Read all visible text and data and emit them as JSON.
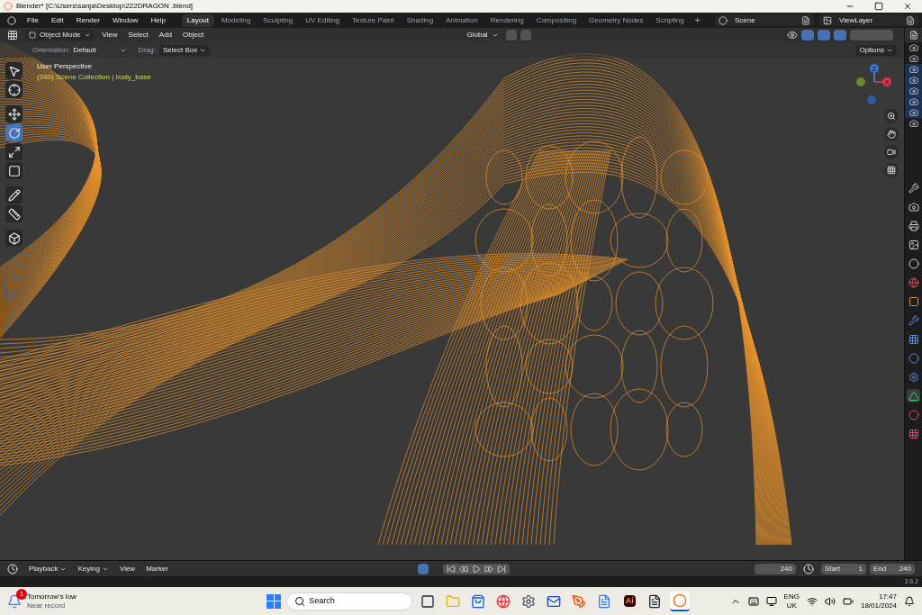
{
  "window": {
    "title": "Blender* [C:\\Users\\sanja\\Desktop\\222DRAGON .blend]"
  },
  "menu": [
    "File",
    "Edit",
    "Render",
    "Window",
    "Help"
  ],
  "workspaces": [
    {
      "label": "Layout",
      "selected": true
    },
    {
      "label": "Modeling",
      "selected": false
    },
    {
      "label": "Sculpting",
      "selected": false
    },
    {
      "label": "UV Editing",
      "selected": false
    },
    {
      "label": "Texture Paint",
      "selected": false
    },
    {
      "label": "Shading",
      "selected": false
    },
    {
      "label": "Animation",
      "selected": false
    },
    {
      "label": "Rendering",
      "selected": false
    },
    {
      "label": "Compositing",
      "selected": false
    },
    {
      "label": "Geometry Nodes",
      "selected": false
    },
    {
      "label": "Scripting",
      "selected": false
    }
  ],
  "add_workspace": "+",
  "scene": "Scene",
  "view_layer": "ViewLayer",
  "header": {
    "mode": "Object Mode",
    "menus": [
      "View",
      "Select",
      "Add",
      "Object"
    ],
    "transform": "Global"
  },
  "tool_settings": {
    "orientation_label": "Orientation:",
    "orientation": "Default",
    "drag_label": "Drag:",
    "drag": "Select Box",
    "options": "Options"
  },
  "viewport": {
    "view_name": "User Perspective",
    "collection": "(240) Scene Collection | body_base",
    "axes": [
      "Z",
      "X"
    ]
  },
  "toolbar": [
    {
      "kind": "select",
      "selected": false
    },
    {
      "kind": "cursor",
      "selected": false
    },
    {
      "kind": "move",
      "selected": false
    },
    {
      "kind": "rotate",
      "selected": true
    },
    {
      "kind": "scale",
      "selected": false
    },
    {
      "kind": "transform",
      "selected": false
    },
    {
      "kind": "annotate",
      "selected": false
    },
    {
      "kind": "measure",
      "selected": false
    },
    {
      "kind": "add",
      "selected": false
    }
  ],
  "outliner": [
    {
      "selected": false
    },
    {
      "selected": false
    },
    {
      "selected": true
    },
    {
      "selected": true
    },
    {
      "selected": true
    },
    {
      "selected": true
    },
    {
      "selected": true
    },
    {
      "selected": false
    }
  ],
  "properties_tabs": [
    {
      "kind": "tool",
      "selected": false
    },
    {
      "kind": "render",
      "selected": false
    },
    {
      "kind": "output",
      "selected": false
    },
    {
      "kind": "view_layer",
      "selected": false
    },
    {
      "kind": "scene",
      "selected": false
    },
    {
      "kind": "world",
      "selected": false
    },
    {
      "kind": "object",
      "selected": false
    },
    {
      "kind": "modifier",
      "selected": false
    },
    {
      "kind": "particles",
      "selected": false
    },
    {
      "kind": "physics",
      "selected": false
    },
    {
      "kind": "constraints",
      "selected": false
    },
    {
      "kind": "data",
      "selected": true
    },
    {
      "kind": "material",
      "selected": false
    },
    {
      "kind": "texture",
      "selected": false
    }
  ],
  "timeline": {
    "menus": [
      "Playback",
      "Keying",
      "View",
      "Marker"
    ],
    "current_frame": "240",
    "start_label": "Start",
    "start": "1",
    "end_label": "End",
    "end": "240"
  },
  "status_bar": {
    "version": "3.6.2"
  },
  "taskbar": {
    "weather_badge": "1",
    "weather_title": "Tomorrow's low",
    "weather_sub": "Near record",
    "search": "Search",
    "apps": [
      {
        "kind": "widgets",
        "selected": false
      },
      {
        "kind": "files",
        "selected": false
      },
      {
        "kind": "store",
        "selected": false
      },
      {
        "kind": "chrome",
        "selected": false
      },
      {
        "kind": "settings",
        "selected": false
      },
      {
        "kind": "outlook",
        "selected": false
      },
      {
        "kind": "paint",
        "selected": false
      },
      {
        "kind": "whiteboard",
        "selected": false
      },
      {
        "kind": "illustrator",
        "selected": false
      },
      {
        "kind": "notes",
        "selected": false
      },
      {
        "kind": "blender",
        "selected": true
      }
    ],
    "illustrator_label": "Ai",
    "language": "ENG",
    "region": "UK",
    "time": "17:47",
    "date": "18/01/2024"
  }
}
